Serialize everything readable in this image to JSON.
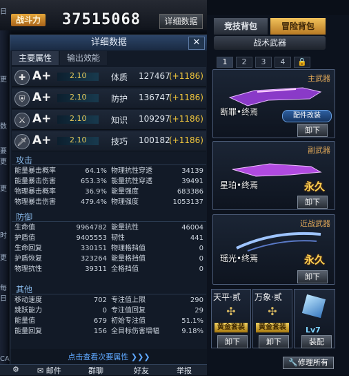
{
  "top": {
    "power_label": "战斗力",
    "power_value": "37515068",
    "detail_button": "详细数据"
  },
  "left_strip": [
    "日",
    "更",
    "数",
    "要更",
    "更",
    "时",
    "更",
    "每日",
    "CA"
  ],
  "panel": {
    "title": "详细数据",
    "close_label": "✕",
    "tabs": [
      {
        "label": "主要属性"
      },
      {
        "label": "输出效能"
      }
    ],
    "attributes": [
      {
        "icon": "plus-shield-icon",
        "icon_glyph": "✚",
        "grade": "A+",
        "multiplier": "2.10",
        "name": "体质",
        "value": "127467",
        "bonus": "(+1186)"
      },
      {
        "icon": "shield-icon",
        "icon_glyph": "⛨",
        "grade": "A+",
        "multiplier": "2.10",
        "name": "防护",
        "value": "136747",
        "bonus": "(+1186)"
      },
      {
        "icon": "sword-knowledge-icon",
        "icon_glyph": "⚔",
        "grade": "A+",
        "multiplier": "2.10",
        "name": "知识",
        "value": "109297",
        "bonus": "(+1186)"
      },
      {
        "icon": "sword-skill-icon",
        "icon_glyph": "🗡",
        "grade": "A+",
        "multiplier": "2.10",
        "name": "技巧",
        "value": "100182",
        "bonus": "(+1186)"
      }
    ],
    "attack": {
      "title": "攻击",
      "rows": [
        {
          "l_label": "能量暴击概率",
          "l_value": "64.1%",
          "r_label": "物理抗性穿透",
          "r_value": "34139"
        },
        {
          "l_label": "能量暴击伤害",
          "l_value": "653.3%",
          "r_label": "能量抗性穿透",
          "r_value": "39491"
        },
        {
          "l_label": "物理暴击概率",
          "l_value": "36.9%",
          "r_label": "能量强度",
          "r_value": "683386"
        },
        {
          "l_label": "物理暴击伤害",
          "l_value": "479.4%",
          "r_label": "物理强度",
          "r_value": "1053137"
        }
      ]
    },
    "defense": {
      "title": "防御",
      "rows": [
        {
          "l_label": "生命值",
          "l_value": "9964782",
          "r_label": "能量抗性",
          "r_value": "46004"
        },
        {
          "l_label": "护盾值",
          "l_value": "9405553",
          "r_label": "韧性",
          "r_value": "441"
        },
        {
          "l_label": "生命回复",
          "l_value": "330151",
          "r_label": "物理格挡值",
          "r_value": "0"
        },
        {
          "l_label": "护盾恢复",
          "l_value": "323264",
          "r_label": "能量格挡值",
          "r_value": "0"
        },
        {
          "l_label": "物理抗性",
          "l_value": "39311",
          "r_label": "全格挡值",
          "r_value": "0"
        }
      ]
    },
    "other": {
      "title": "其他",
      "rows": [
        {
          "l_label": "移动速度",
          "l_value": "702",
          "r_label": "专注值上限",
          "r_value": "290"
        },
        {
          "l_label": "跳跃能力",
          "l_value": "0",
          "r_label": "专注值回复",
          "r_value": "29"
        },
        {
          "l_label": "能量值",
          "l_value": "679",
          "r_label": "初始专注值",
          "r_value": "51.1%"
        },
        {
          "l_label": "能量回复",
          "l_value": "156",
          "r_label": "全目标伤害增幅",
          "r_value": "9.18%"
        }
      ]
    },
    "more_link": "点击查看次要属性 ❯❯❯"
  },
  "bottom_bar": [
    {
      "icon": "gear-icon",
      "label": "⚙"
    },
    {
      "icon": "mail-icon",
      "label": "✉ 邮件"
    },
    {
      "icon": "group-icon",
      "label": "群聊"
    },
    {
      "icon": "friend-icon",
      "label": "好友"
    },
    {
      "icon": "report-icon",
      "label": "举报"
    }
  ],
  "bag": {
    "tabs": [
      {
        "label": "竞技背包"
      },
      {
        "label": "冒险背包"
      }
    ],
    "sub_title": "战术武器",
    "pages": [
      "1",
      "2",
      "3",
      "4"
    ],
    "lock_icon": "🔒",
    "weapons": [
      {
        "slot": "主武器",
        "name": "断罪•终焉",
        "action": "卸下",
        "mod_button": "配件改装",
        "color": "#b85cff"
      },
      {
        "slot": "副武器",
        "name": "星珀•终焉",
        "action": "卸下",
        "permanent": "永久",
        "color": "#d070ff"
      },
      {
        "slot": "近战武器",
        "name": "瑶光•终焉",
        "action": "卸下",
        "permanent": "永久",
        "color": "#8fb6ff"
      }
    ],
    "small_items": [
      {
        "name": "天平·贰",
        "badge": "黄金套装",
        "action": "卸下"
      },
      {
        "name": "万象·贰",
        "badge": "黄金套装",
        "action": "卸下"
      },
      {
        "name": "",
        "level": "Lv7",
        "action": "装配"
      }
    ],
    "repair_button": "🔧修理所有"
  }
}
